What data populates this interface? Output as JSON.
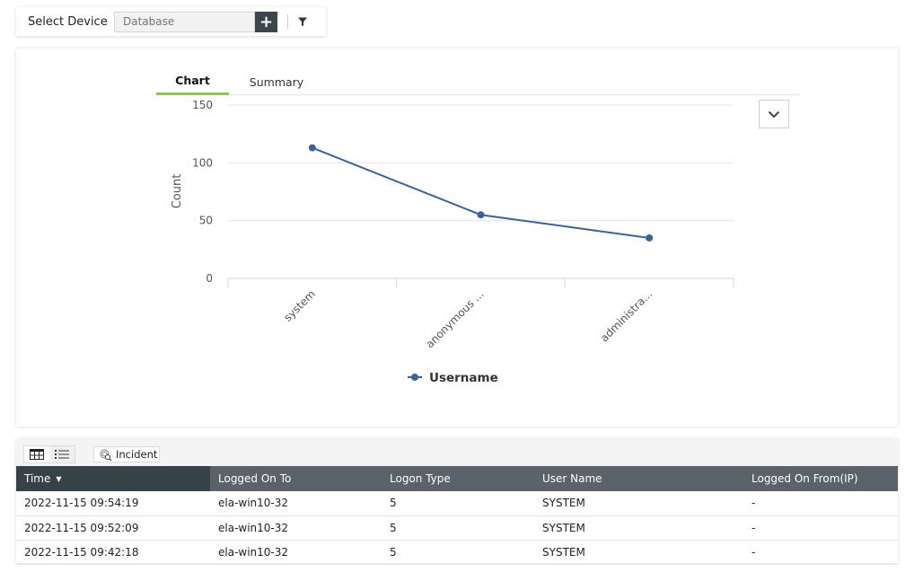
{
  "toolbar": {
    "select_device_label": "Select Device",
    "device_input_placeholder": "Database",
    "add_button_label": "+",
    "filter_icon": "filter-icon"
  },
  "tabs": [
    {
      "label": "Chart",
      "active": true
    },
    {
      "label": "Summary",
      "active": false
    }
  ],
  "collapse_icon": "chevron-down-icon",
  "chart_data": {
    "type": "line",
    "title": "",
    "xlabel": "",
    "ylabel": "Count",
    "categories": [
      "system",
      "anonymous ...",
      "administra..."
    ],
    "series": [
      {
        "name": "Username",
        "values": [
          113,
          55,
          35
        ],
        "color": "#3d6298"
      }
    ],
    "ylim": [
      0,
      150
    ],
    "yticks": [
      0,
      50,
      100,
      150
    ],
    "grid": true,
    "legend": "bottom-center"
  },
  "grid": {
    "view_icons": [
      "table-view-icon",
      "list-view-icon"
    ],
    "incident_label": "Incident",
    "columns": [
      "Time",
      "Logged On To",
      "Logon Type",
      "User Name",
      "Logged On From(IP)"
    ],
    "sorted_column": "Time",
    "rows": [
      [
        "2022-11-15 09:54:19",
        "ela-win10-32",
        "5",
        "SYSTEM",
        "-"
      ],
      [
        "2022-11-15 09:52:09",
        "ela-win10-32",
        "5",
        "SYSTEM",
        "-"
      ],
      [
        "2022-11-15 09:42:18",
        "ela-win10-32",
        "5",
        "SYSTEM",
        "-"
      ]
    ]
  }
}
